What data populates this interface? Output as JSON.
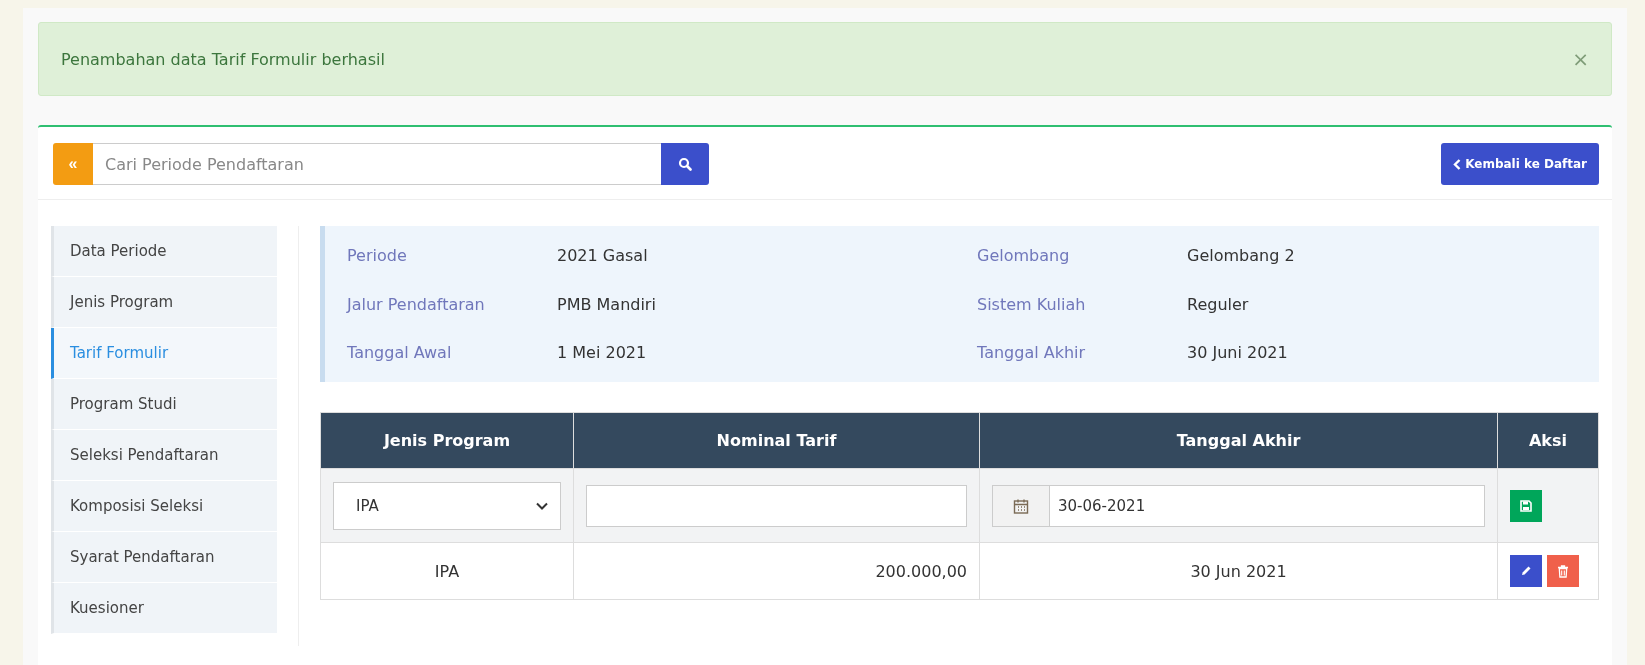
{
  "alert": {
    "message": "Penambahan data Tarif Formulir berhasil",
    "close": "×"
  },
  "search": {
    "toggle": "«",
    "placeholder": "Cari Periode Pendaftaran"
  },
  "back_button": {
    "label": "Kembali ke Daftar"
  },
  "sidebar": {
    "items": [
      {
        "label": "Data Periode",
        "selected": false
      },
      {
        "label": "Jenis Program",
        "selected": false
      },
      {
        "label": "Tarif Formulir",
        "selected": true
      },
      {
        "label": "Program Studi",
        "selected": false
      },
      {
        "label": "Seleksi Pendaftaran",
        "selected": false
      },
      {
        "label": "Komposisi Seleksi",
        "selected": false
      },
      {
        "label": "Syarat Pendaftaran",
        "selected": false
      },
      {
        "label": "Kuesioner",
        "selected": false
      }
    ]
  },
  "info": [
    {
      "label": "Periode",
      "value": "2021 Gasal"
    },
    {
      "label": "Gelombang",
      "value": "Gelombang 2"
    },
    {
      "label": "Jalur Pendaftaran",
      "value": "PMB Mandiri"
    },
    {
      "label": "Sistem Kuliah",
      "value": "Reguler"
    },
    {
      "label": "Tanggal Awal",
      "value": "1 Mei 2021"
    },
    {
      "label": "Tanggal Akhir",
      "value": "30 Juni 2021"
    }
  ],
  "table": {
    "columns": [
      "Jenis Program",
      "Nominal Tarif",
      "Tanggal Akhir",
      "Aksi"
    ],
    "form": {
      "program": "IPA",
      "date": "30-06-2021"
    },
    "rows": [
      {
        "program": "IPA",
        "tarif": "200.000,00",
        "date": "30 Jun 2021"
      }
    ]
  }
}
